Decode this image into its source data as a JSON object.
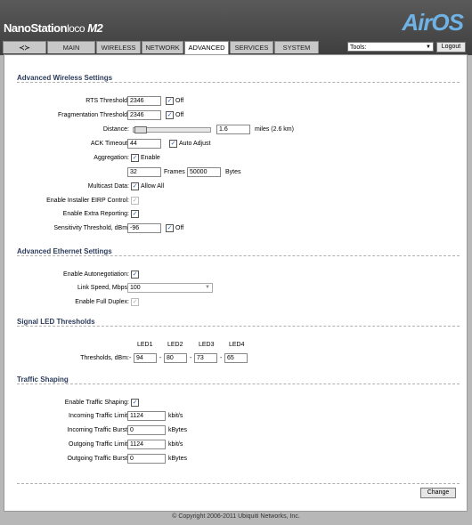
{
  "brand": {
    "name": "NanoStation",
    "loco": "loco",
    "model": "M2",
    "airos": "AirOS"
  },
  "tabs": [
    {
      "label": "MAIN"
    },
    {
      "label": "WIRELESS"
    },
    {
      "label": "NETWORK"
    },
    {
      "label": "ADVANCED"
    },
    {
      "label": "SERVICES"
    },
    {
      "label": "SYSTEM"
    }
  ],
  "tools": {
    "label": "Tools:",
    "logout": "Logout"
  },
  "wireless": {
    "title": "Advanced Wireless Settings",
    "rts_label": "RTS Threshold:",
    "rts_value": "2346",
    "rts_off": "Off",
    "frag_label": "Fragmentation Threshold:",
    "frag_value": "2346",
    "frag_off": "Off",
    "distance_label": "Distance:",
    "distance_value": "1.6",
    "distance_unit": "miles (2.6 km)",
    "ack_label": "ACK Timeout:",
    "ack_value": "44",
    "ack_auto": "Auto Adjust",
    "agg_label": "Aggregation:",
    "agg_enable": "Enable",
    "agg_frames": "32",
    "agg_frames_label": "Frames",
    "agg_bytes": "50000",
    "agg_bytes_label": "Bytes",
    "mcast_label": "Multicast Data:",
    "mcast_allow": "Allow All",
    "eirp_label": "Enable Installer EIRP Control:",
    "extra_label": "Enable Extra Reporting:",
    "sens_label": "Sensitivity Threshold, dBm:",
    "sens_value": "-96",
    "sens_off": "Off"
  },
  "ethernet": {
    "title": "Advanced Ethernet Settings",
    "autoneg_label": "Enable Autonegotiation:",
    "speed_label": "Link Speed, Mbps:",
    "speed_value": "100",
    "duplex_label": "Enable Full Duplex:"
  },
  "led": {
    "title": "Signal LED Thresholds",
    "headers": [
      "LED1",
      "LED2",
      "LED3",
      "LED4"
    ],
    "label": "Thresholds, dBm:",
    "minus": "-",
    "values": [
      "94",
      "80",
      "73",
      "65"
    ]
  },
  "traffic": {
    "title": "Traffic Shaping",
    "enable_label": "Enable Traffic Shaping:",
    "in_limit_label": "Incoming Traffic Limit:",
    "in_limit_value": "1124",
    "in_limit_unit": "kbit/s",
    "in_burst_label": "Incoming Traffic Burst:",
    "in_burst_value": "0",
    "in_burst_unit": "kBytes",
    "out_limit_label": "Outgoing Traffic Limit:",
    "out_limit_value": "1124",
    "out_limit_unit": "kbit/s",
    "out_burst_label": "Outgoing Traffic Burst:",
    "out_burst_value": "0",
    "out_burst_unit": "kBytes"
  },
  "change_label": "Change",
  "footer": "© Copyright 2006-2011 Ubiquiti Networks, Inc.",
  "colors": {
    "accent": "#6fb3e6",
    "section_title": "#2c3c5c"
  }
}
